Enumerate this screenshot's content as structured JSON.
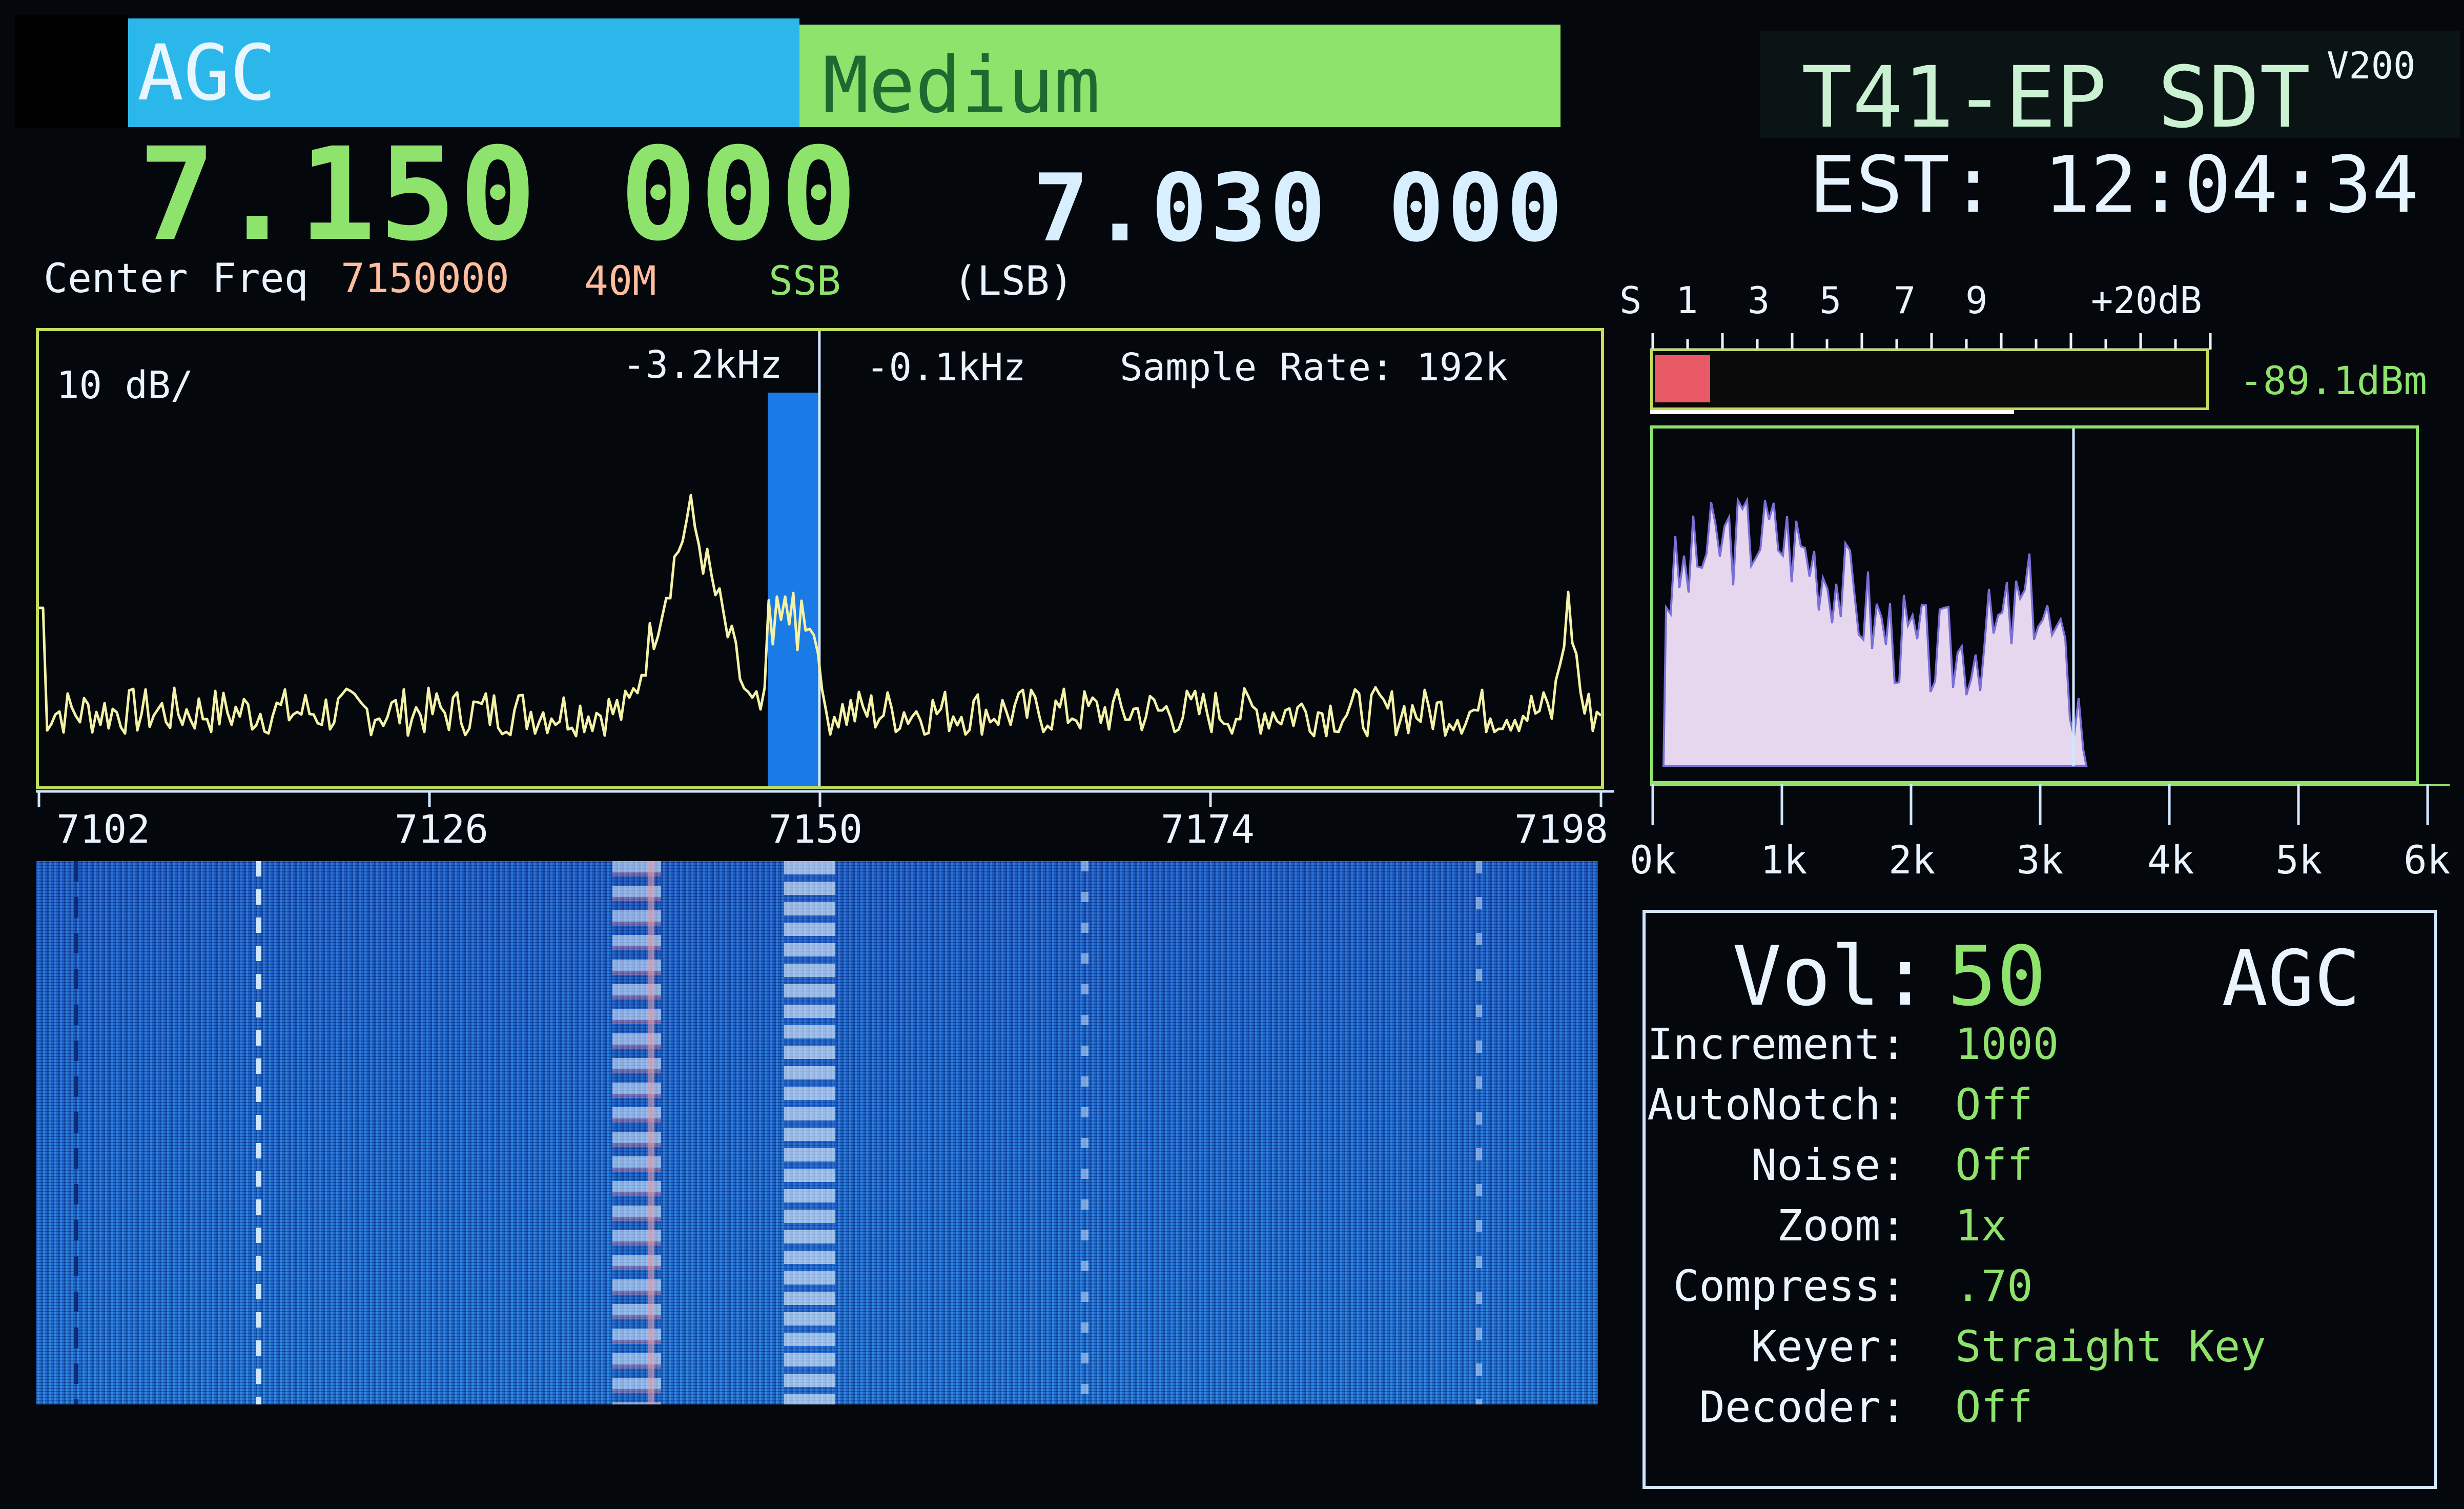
{
  "top_bar": {
    "agc_label": "AGC",
    "agc_mode": "Medium"
  },
  "title": {
    "name": "T41-EP SDT",
    "version": "V200"
  },
  "clock": {
    "text": "EST: 12:04:34"
  },
  "frequency": {
    "main": "7.150 000",
    "secondary": "7.030 000",
    "center_label": "Center Freq",
    "center_value": "7150000",
    "band": "40M",
    "mode": "SSB",
    "sideband": "(LSB)"
  },
  "spectrum": {
    "scale": "10 dB/",
    "offset_left": "-3.2kHz",
    "offset_right": "-0.1kHz",
    "sample_rate_label": "Sample Rate: 192k",
    "freq_labels": [
      "7102",
      "7126",
      "7150",
      "7174",
      "7198"
    ],
    "freq_range": [
      7102,
      7198
    ],
    "passband_khz": [
      7146.8,
      7149.9
    ]
  },
  "smeter": {
    "labels": [
      "S",
      "1",
      "3",
      "5",
      "7",
      "9",
      "+20dB"
    ],
    "level_fraction": 0.1,
    "reading": "-89.1dBm"
  },
  "audio": {
    "axis_labels": [
      "0k",
      "1k",
      "2k",
      "3k",
      "4k",
      "5k",
      "6k"
    ],
    "cutoff_khz": 3.2
  },
  "settings": {
    "vol_label": "Vol:",
    "vol_value": "50",
    "agc_label": "AGC",
    "rows": [
      {
        "label": "Increment:",
        "value": "1000"
      },
      {
        "label": "AutoNotch:",
        "value": "Off"
      },
      {
        "label": "Noise:",
        "value": "Off"
      },
      {
        "label": "Zoom:",
        "value": "1x"
      },
      {
        "label": "Compress:",
        "value": ".70"
      },
      {
        "label": "Keyer:",
        "value": "Straight Key"
      },
      {
        "label": "Decoder:",
        "value": "Off"
      }
    ]
  },
  "colors": {
    "accent_green": "#8ee36c",
    "agc_blue": "#2bb7ea",
    "spectrum_trace": "#f3f2a8",
    "passband_blue": "#1a7be6",
    "smeter_red": "#e85a66",
    "audio_fill": "#e6d7ee"
  }
}
